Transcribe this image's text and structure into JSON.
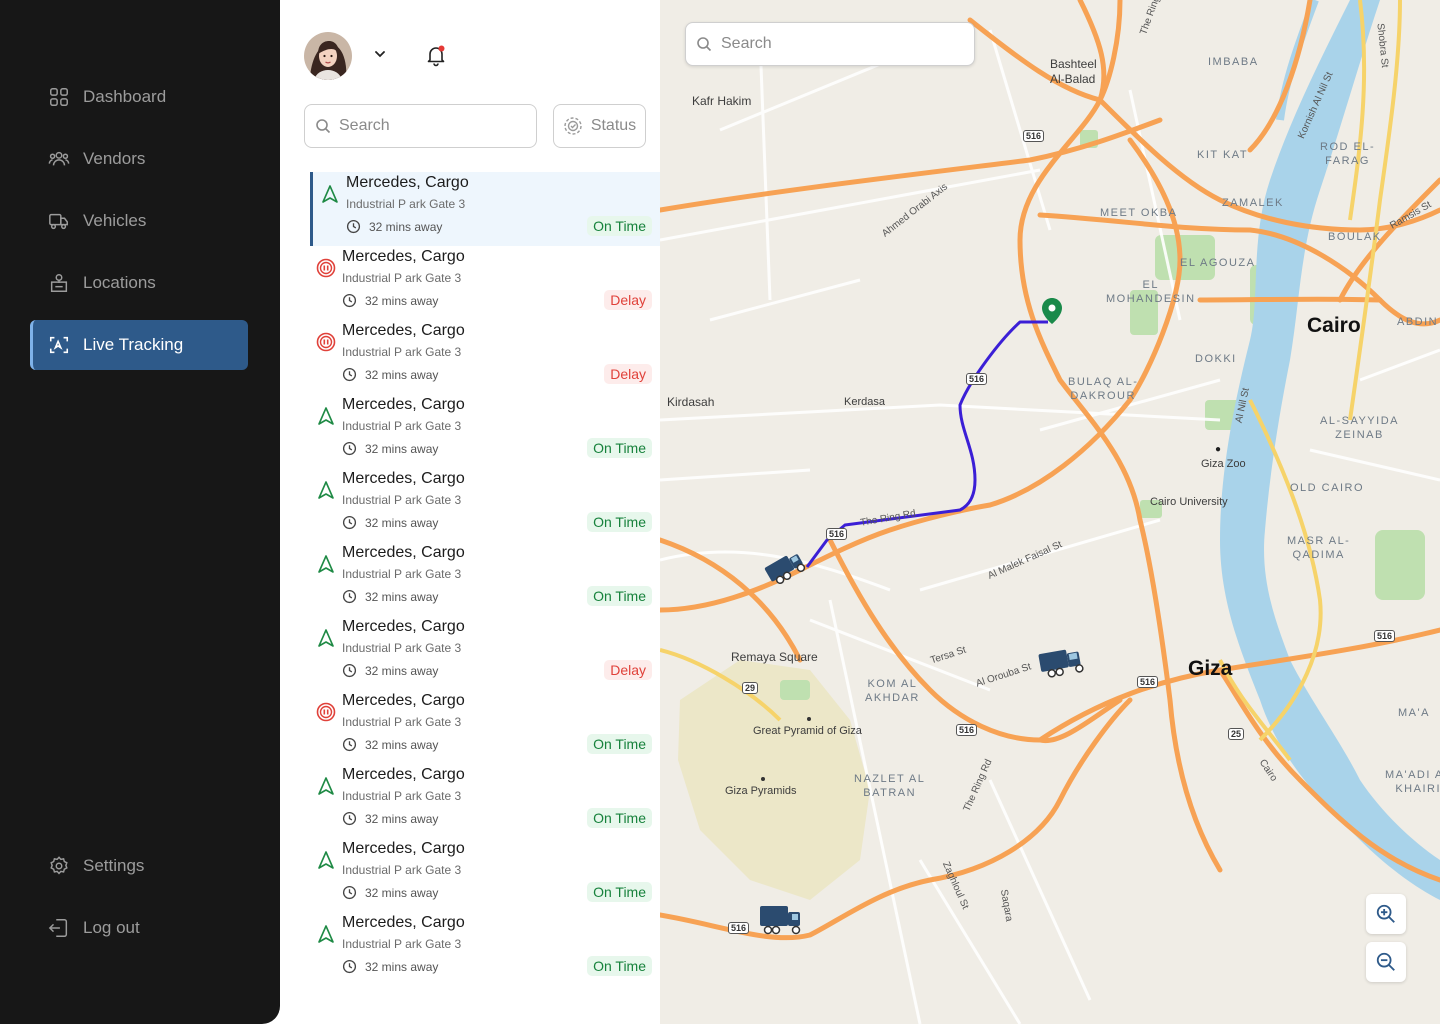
{
  "sidebar": {
    "items": [
      {
        "label": "Dashboard",
        "icon": "dashboard-icon"
      },
      {
        "label": "Vendors",
        "icon": "vendors-icon"
      },
      {
        "label": "Vehicles",
        "icon": "vehicles-icon"
      },
      {
        "label": "Locations",
        "icon": "locations-icon"
      },
      {
        "label": "Live Tracking",
        "icon": "live-tracking-icon",
        "active": true
      }
    ],
    "bottom_items": [
      {
        "label": "Settings",
        "icon": "gear-icon"
      },
      {
        "label": "Log out",
        "icon": "logout-icon"
      }
    ]
  },
  "list_panel": {
    "search_placeholder": "Search",
    "status_label": "Status",
    "vehicles": [
      {
        "title": "Mercedes, Cargo",
        "location": "Industrial P ark Gate 3",
        "eta": "32 mins away",
        "status": "On Time",
        "state": "navigating",
        "selected": true
      },
      {
        "title": "Mercedes, Cargo",
        "location": "Industrial P ark Gate 3",
        "eta": "32 mins away",
        "status": "Delay",
        "state": "stopped"
      },
      {
        "title": "Mercedes, Cargo",
        "location": "Industrial P ark Gate 3",
        "eta": "32 mins away",
        "status": "Delay",
        "state": "stopped"
      },
      {
        "title": "Mercedes, Cargo",
        "location": "Industrial P ark Gate 3",
        "eta": "32 mins away",
        "status": "On Time",
        "state": "navigating"
      },
      {
        "title": "Mercedes, Cargo",
        "location": "Industrial P ark Gate 3",
        "eta": "32 mins away",
        "status": "On Time",
        "state": "navigating"
      },
      {
        "title": "Mercedes, Cargo",
        "location": "Industrial P ark Gate 3",
        "eta": "32 mins away",
        "status": "On Time",
        "state": "navigating"
      },
      {
        "title": "Mercedes, Cargo",
        "location": "Industrial P ark Gate 3",
        "eta": "32 mins away",
        "status": "Delay",
        "state": "navigating"
      },
      {
        "title": "Mercedes, Cargo",
        "location": "Industrial P ark Gate 3",
        "eta": "32 mins away",
        "status": "On Time",
        "state": "stopped"
      },
      {
        "title": "Mercedes, Cargo",
        "location": "Industrial P ark Gate 3",
        "eta": "32 mins away",
        "status": "On Time",
        "state": "navigating"
      },
      {
        "title": "Mercedes, Cargo",
        "location": "Industrial P ark Gate 3",
        "eta": "32 mins away",
        "status": "On Time",
        "state": "navigating"
      },
      {
        "title": "Mercedes, Cargo",
        "location": "Industrial P ark Gate 3",
        "eta": "32 mins away",
        "status": "On Time",
        "state": "navigating"
      }
    ]
  },
  "map": {
    "search_placeholder": "Search",
    "places": {
      "bashteel": "Bashteel",
      "al_balad": "Al-Balad",
      "kafr_hakim": "Kafr Hakim",
      "kirdasah": "Kirdasah",
      "kerdasa": "Kerdasa",
      "remaya": "Remaya Square",
      "great_pyramid": "Great Pyramid of Giza",
      "giza_pyramids": "Giza Pyramids",
      "cairo": "Cairo",
      "giza": "Giza",
      "giza_zoo": "Giza Zoo",
      "cairo_university": "Cairo University"
    },
    "districts": {
      "imbaba": "IMBABA",
      "kit_kat": "KIT KAT",
      "rod_el_farag": "ROD EL-\nFARAG",
      "meet_okba": "MEET OKBA",
      "zamalek": "ZAMALEK",
      "boulak": "BOULAK",
      "el_agouza": "EL AGOUZA",
      "el_mohandesin": "EL\nMOHANDESIN",
      "abdin": "ABDIN",
      "dokki": "DOKKI",
      "bulaq_dakrour": "BULAQ AL-\nDAKROUR",
      "al_sayyida_zeinab": "AL-SAYYIDA\nZEINAB",
      "old_cairo": "OLD CAIRO",
      "masr_al_qadima": "MASR AL-\nQADIMA",
      "kom_al_akhdar": "KOM AL\nAKHDAR",
      "nazlet_al_batran": "NAZLET AL\nBATRAN",
      "ma_a": "MA'A",
      "maadi_khairi": "MA'ADI AL\nKHAIRI"
    },
    "roads": {
      "ahmed_orabi": "Ahmed Orabi Axis",
      "ring_rd": "The Ring Rd",
      "ring_rd_2": "The Ring Rd",
      "al_malek_faisal": "Al Malek Faisal St",
      "tersa": "Tersa St",
      "al_orouba": "Al Orouba St",
      "zaghloul": "Zaghloul St",
      "saqara": "Saqara",
      "kornish": "Kornish Al Nil St",
      "shobra": "Shobra St",
      "ramsis": "Ramsis St",
      "al_nil": "Al Nil St",
      "cairo_road": "Cairo",
      "the_ring_top": "The Ring"
    },
    "shields": {
      "r516a": "516",
      "r516b": "516",
      "r516c": "516",
      "r516d": "516",
      "r516e": "516",
      "r516f": "516",
      "r29": "29",
      "r25": "25"
    },
    "colors": {
      "route": "#3b1fd6",
      "destination_pin": "#1a8a4a",
      "major_road": "#f7a254",
      "water": "#a9d3ea"
    }
  }
}
